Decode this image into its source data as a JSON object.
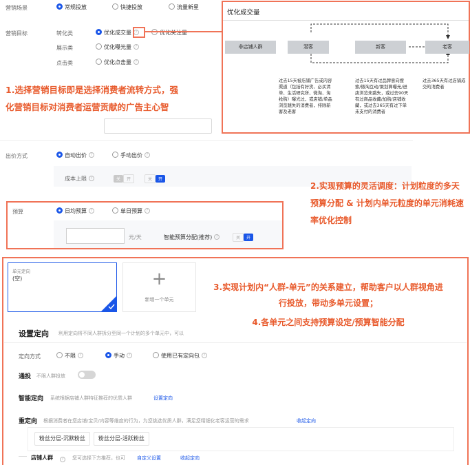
{
  "form": {
    "scene": {
      "label": "营销场景",
      "options": [
        "常规投放",
        "快捷投放",
        "流量新星"
      ]
    },
    "target": {
      "label": "营销目标",
      "rows": [
        {
          "category": "转化类",
          "options": [
            "优化成交量",
            "优化关注量"
          ]
        },
        {
          "category": "展示类",
          "options": [
            "优化曝光量"
          ]
        },
        {
          "category": "点击类",
          "options": [
            "优化点击量"
          ]
        }
      ]
    },
    "bid": {
      "label": "出价方式",
      "options": [
        "自动出价",
        "手动出价"
      ],
      "cost_cap_label": "成本上限",
      "toggle_a": [
        "关",
        "开"
      ],
      "toggle_b": [
        "关",
        "开"
      ]
    },
    "budget": {
      "label": "预算",
      "options": [
        "日均预算",
        "单日预算"
      ],
      "unit": "元/天",
      "smart_label": "智能预算分配(推荐)",
      "toggle": [
        "关",
        "开"
      ]
    }
  },
  "popup": {
    "title": "优化成交量",
    "stages": [
      "非店铺人群",
      "潜客",
      "新客",
      "老客"
    ],
    "descriptions": [
      "过去15天被店铺广告或内容渠道（包括有好货、必买清单、生活研究所、微淘、淘抢购）曝光过，或店铺/单品浏览跳失的消费者，排除新客及老客",
      "过去15天有过品牌意向搜索/微淘互动/聚划算曝光/进店浏览未跳失，或过去90天有过商品收藏/加购/店铺收藏，或过去365天有过下单未支付的消费者",
      "过去365天有过店铺成交的消费者"
    ]
  },
  "annotations": {
    "a1": "1.选择营销目标即是选择消费者流转方式，强化营销目标对消费者运营贡献的广告主心智",
    "a2": "2.实现预算的灵活调度：计划粒度的多天预算分配 & 计划内单元粒度的单元消耗速率优化控制",
    "a3": "3.实现计划内“人群-单元”的关系建立，帮助客户以人群视角进行投放，带动多单元设置；",
    "a4": "4.各单元之间支持预算设定/预算智能分配"
  },
  "unit": {
    "card_label": "单元定向",
    "card_value": "(空)",
    "add_symbol": "+",
    "add_label": "新增一个单元"
  },
  "targeting": {
    "title": "设置定向",
    "desc": "利用定向将不同人群拆分至同一个计划的多个单元中，可以",
    "method_label": "定向方式",
    "method_options": [
      "不限",
      "手动",
      "使用已有定向包"
    ],
    "tongtou": {
      "title": "通投",
      "desc": "不限人群投放"
    },
    "smart": {
      "title": "智能定向",
      "desc": "系统根据店铺人群特征推荐的优质人群",
      "link": "设置定向"
    },
    "retarget": {
      "title": "重定向",
      "desc": "根据消费者在您店铺/宝贝/内容等维度的行为，为您挑选优质人群，满足您精细化老客运营的需求",
      "link": "收起定向",
      "tags": [
        "粉丝分层-沉默粉丝",
        "粉丝分层-活跃粉丝"
      ]
    },
    "store": {
      "title": "店铺人群",
      "desc": "您可选择下方推荐，也可",
      "custom_link": "自定义设置",
      "link": "收起定向"
    }
  },
  "colors": {
    "accent": "#1a56e8",
    "annotation": "#e85a2c",
    "box": "#f07357"
  }
}
